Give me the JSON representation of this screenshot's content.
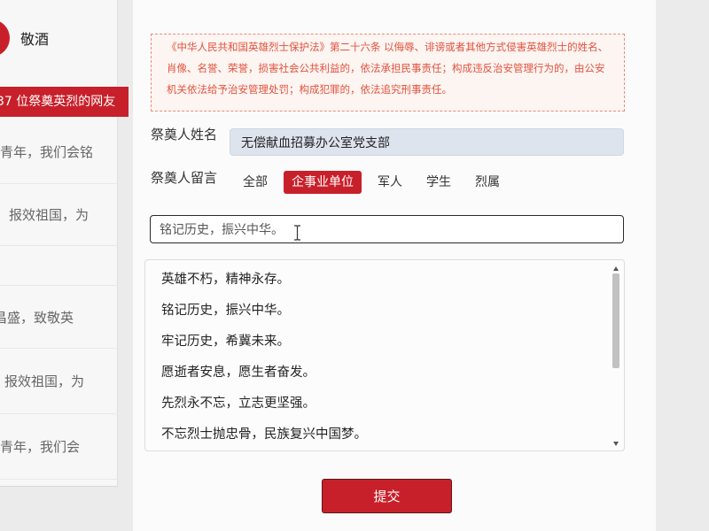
{
  "sidebar": {
    "toast_label": "敬酒",
    "banner": "37 位祭奠英烈的网友",
    "messages": [
      "青年，我们会铭",
      "报效祖国，为",
      "昌盛，致敬英",
      "报效祖国，为",
      "青年，我们会"
    ]
  },
  "notice": {
    "text": "《中华人民共和国英雄烈士保护法》第二十六条 以侮辱、诽谤或者其他方式侵害英雄烈士的姓名、肖像、名誉、荣誉，损害社会公共利益的，依法承担民事责任；构成违反治安管理行为的，由公安机关依法给予治安管理处罚；构成犯罪的，依法追究刑事责任。"
  },
  "form": {
    "name_label": "祭奠人姓名",
    "name_value": "无偿献血招募办公室党支部",
    "message_label": "祭奠人留言",
    "categories": [
      {
        "label": "全部",
        "active": false
      },
      {
        "label": "企事业单位",
        "active": true
      },
      {
        "label": "军人",
        "active": false
      },
      {
        "label": "学生",
        "active": false
      },
      {
        "label": "烈属",
        "active": false
      }
    ],
    "message_value": "铭记历史，振兴中华。",
    "suggestions": [
      "英雄不朽，精神永存。",
      "铭记历史，振兴中华。",
      "牢记历史，希冀未来。",
      "愿逝者安息，愿生者奋发。",
      "先烈永不忘，立志更坚强。",
      "不忘烈士抛忠骨，民族复兴中国梦。"
    ],
    "suggestion_scroll": {
      "offset": 0,
      "visible_fraction": 0.57
    },
    "submit_label": "提交"
  },
  "icons": {
    "toast": "toast-icon",
    "text_cursor": "text-cursor-icon",
    "scroll_up": "scroll-up-icon",
    "scroll_down": "scroll-down-icon"
  },
  "colors": {
    "accent": "#c8202a",
    "notice_text": "#e2523f",
    "notice_border": "#eb8d7c",
    "notice_bg": "#fdf5f1",
    "name_field_bg": "#dee4ed"
  }
}
